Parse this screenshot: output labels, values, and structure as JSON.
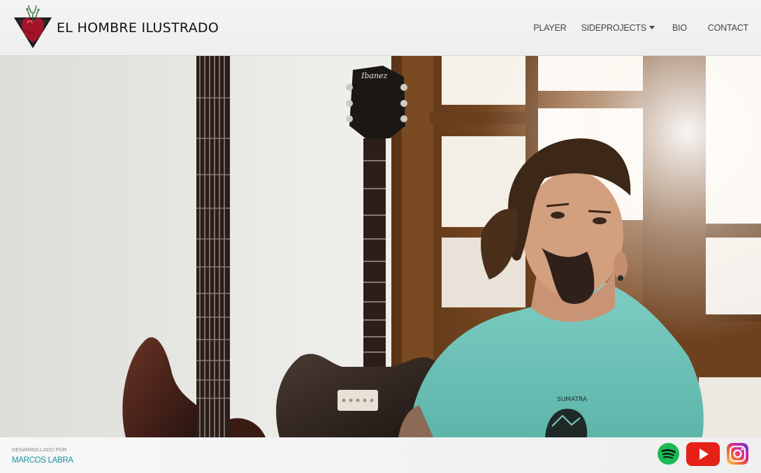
{
  "header": {
    "brand": "EL HOMBRE ILUSTRADO",
    "logo_icon": "anatomical-heart-triangle-logo",
    "nav": [
      {
        "label": "PLAYER",
        "dropdown": false
      },
      {
        "label": "SIDEPROJECTS",
        "dropdown": true
      },
      {
        "label": "BIO",
        "dropdown": false
      },
      {
        "label": "CONTACT",
        "dropdown": false
      }
    ]
  },
  "hero": {
    "description_icon": "hero-photo-musician-with-guitars",
    "guitar_brand": "Ibanez",
    "shirt_text": "SUMATRA"
  },
  "footer": {
    "credit_label": "DESARROLLADO POR",
    "credit_name": "MARCOS LABRA",
    "social": [
      {
        "name": "spotify-icon",
        "color": "#1db954"
      },
      {
        "name": "youtube-icon",
        "color": "#e62117"
      },
      {
        "name": "instagram-icon",
        "color": "#d6249f"
      }
    ]
  },
  "colors": {
    "accent": "#1c8fa0",
    "header_bg": "#f2f2f2",
    "text_dark": "#111111"
  }
}
